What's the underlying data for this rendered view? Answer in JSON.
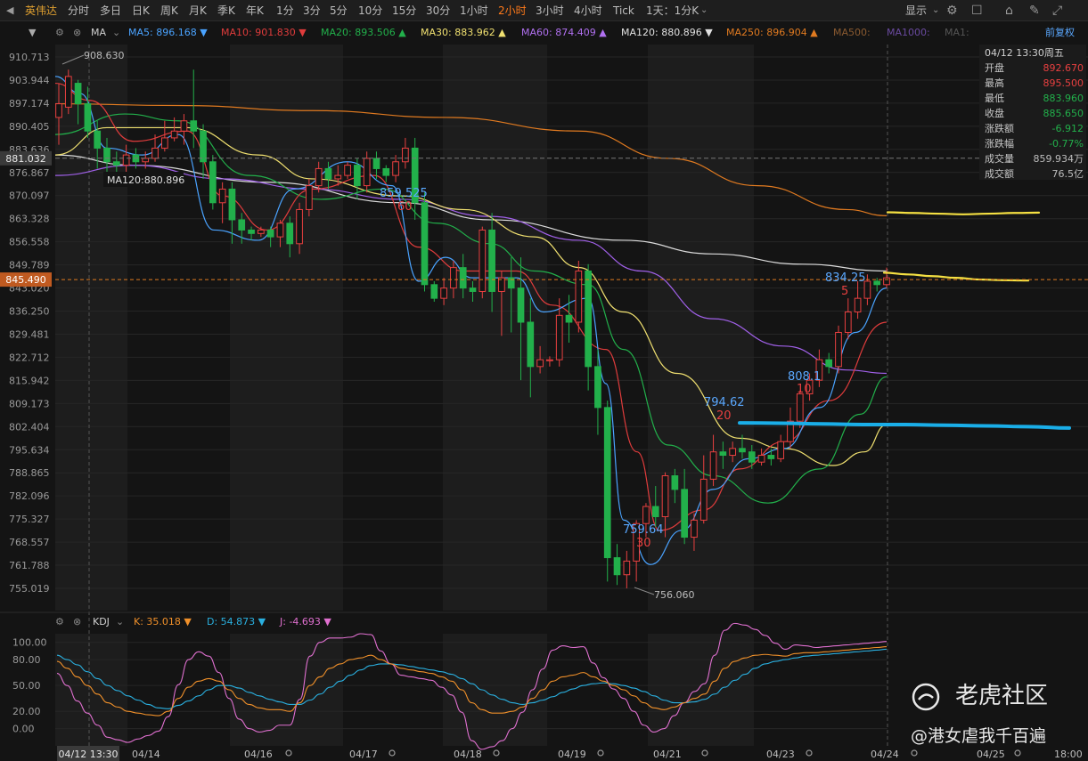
{
  "toolbar": {
    "symbol": "英伟达",
    "periods": [
      "分时",
      "多日",
      "日K",
      "周K",
      "月K",
      "季K",
      "年K",
      "1分",
      "3分",
      "5分",
      "10分",
      "15分",
      "30分",
      "1小时",
      "2小时",
      "3小时",
      "4小时",
      "Tick"
    ],
    "active_period": "2小时",
    "range": "1天：1分K",
    "display": "显示"
  },
  "indicators": {
    "ma_label": "MA",
    "ma": [
      {
        "name": "MA5",
        "value": "896.168",
        "color": "#4aa3ff",
        "dir": "▼"
      },
      {
        "name": "MA10",
        "value": "901.830",
        "color": "#e03c3c",
        "dir": "▼"
      },
      {
        "name": "MA20",
        "value": "893.506",
        "color": "#22b04b",
        "dir": "▲"
      },
      {
        "name": "MA30",
        "value": "883.962",
        "color": "#f0e070",
        "dir": "▲"
      },
      {
        "name": "MA60",
        "value": "874.409",
        "color": "#b070f0",
        "dir": "▲"
      },
      {
        "name": "MA120",
        "value": "880.896",
        "color": "#e0e0e0",
        "dir": "▼"
      },
      {
        "name": "MA250",
        "value": "896.904",
        "color": "#e07a20",
        "dir": "▲"
      },
      {
        "name": "MA500",
        "value": "",
        "color": "#8a5a30",
        "dir": ""
      },
      {
        "name": "MA1000",
        "value": "",
        "color": "#6a4aa0",
        "dir": ""
      },
      {
        "name": "MA1",
        "value": "",
        "color": "#555555",
        "dir": ""
      }
    ],
    "restore": "前复权",
    "kdj_label": "KDJ",
    "kdj": [
      {
        "name": "K",
        "value": "35.018",
        "color": "#f0902a",
        "dir": "▼"
      },
      {
        "name": "D",
        "value": "54.873",
        "color": "#2ab0e0",
        "dir": "▼"
      },
      {
        "name": "J",
        "value": "-4.693",
        "color": "#e070d0",
        "dir": "▼"
      }
    ]
  },
  "info_panel": {
    "datetime": "04/12 13:30周五",
    "rows": [
      {
        "label": "开盘",
        "value": "892.670",
        "color": "#e84040"
      },
      {
        "label": "最高",
        "value": "895.500",
        "color": "#e84040"
      },
      {
        "label": "最低",
        "value": "883.960",
        "color": "#22b04b"
      },
      {
        "label": "收盘",
        "value": "885.650",
        "color": "#22b04b"
      },
      {
        "label": "涨跌额",
        "value": "-6.912",
        "color": "#22b04b"
      },
      {
        "label": "涨跌幅",
        "value": "-0.77%",
        "color": "#22b04b"
      },
      {
        "label": "成交量",
        "value": "859.934万",
        "color": "#bdbdbd"
      },
      {
        "label": "成交额",
        "value": "76.5亿",
        "color": "#bdbdbd"
      }
    ]
  },
  "watermark": {
    "brand": "老虎社区",
    "handle": "@港女虐我千百遍"
  },
  "chart_data": {
    "type": "candlestick",
    "y_ticks": [
      "910.713",
      "903.944",
      "897.174",
      "890.405",
      "883.636",
      "876.867",
      "870.097",
      "863.328",
      "856.558",
      "849.789",
      "843.020",
      "836.250",
      "829.481",
      "822.712",
      "815.942",
      "809.173",
      "802.404",
      "795.634",
      "788.865",
      "782.096",
      "775.327",
      "768.557",
      "761.788",
      "755.019"
    ],
    "y_range": [
      755.019,
      910.713
    ],
    "cursor_price": "881.032",
    "last_price": "845.490",
    "crosshair_label": "MA120:880.896",
    "x_labels": [
      "04/12 13:30",
      "04/14",
      "04/16",
      "04/17",
      "04/18",
      "04/19",
      "04/21",
      "04/23",
      "04/24",
      "04/25",
      "18:00"
    ],
    "candles": [
      [
        893,
        897,
        885,
        903
      ],
      [
        896,
        905,
        894,
        907
      ],
      [
        903,
        897,
        891,
        904
      ],
      [
        897,
        889,
        887,
        902
      ],
      [
        889,
        884,
        878,
        892
      ],
      [
        884,
        880,
        877,
        887
      ],
      [
        880,
        879,
        875,
        883
      ],
      [
        879,
        882,
        876,
        885
      ],
      [
        882,
        880,
        878,
        884
      ],
      [
        880,
        881,
        878,
        883
      ],
      [
        881,
        884,
        880,
        888
      ],
      [
        884,
        887,
        883,
        892
      ],
      [
        887,
        889,
        886,
        893
      ],
      [
        889,
        892,
        885,
        894
      ],
      [
        892,
        889,
        884,
        907
      ],
      [
        889,
        880,
        875,
        891
      ],
      [
        880,
        868,
        866,
        882
      ],
      [
        868,
        872,
        862,
        874
      ],
      [
        872,
        863,
        856,
        874
      ],
      [
        863,
        860,
        856,
        865
      ],
      [
        860,
        859,
        857,
        861
      ],
      [
        859,
        860,
        858,
        861
      ],
      [
        860,
        858,
        855,
        861
      ],
      [
        858,
        862,
        855,
        863
      ],
      [
        862,
        856,
        852,
        864
      ],
      [
        856,
        866,
        853,
        868
      ],
      [
        866,
        873,
        864,
        875
      ],
      [
        873,
        878,
        871,
        880
      ],
      [
        878,
        875,
        872,
        880
      ],
      [
        875,
        876,
        873,
        879
      ],
      [
        876,
        879,
        875,
        880
      ],
      [
        879,
        873,
        869,
        881
      ],
      [
        873,
        881,
        871,
        883
      ],
      [
        881,
        878,
        875,
        883
      ],
      [
        878,
        876,
        874,
        879
      ],
      [
        876,
        880,
        874,
        882
      ],
      [
        880,
        884,
        878,
        887
      ],
      [
        884,
        868,
        863,
        887
      ],
      [
        868,
        844,
        842,
        871
      ],
      [
        844,
        840,
        839,
        845
      ],
      [
        840,
        843,
        838,
        846
      ],
      [
        843,
        849,
        840,
        851
      ],
      [
        849,
        843,
        840,
        853
      ],
      [
        843,
        842,
        839,
        845
      ],
      [
        842,
        860,
        840,
        861
      ],
      [
        860,
        842,
        836,
        865
      ],
      [
        842,
        846,
        829,
        848
      ],
      [
        846,
        843,
        830,
        852
      ],
      [
        843,
        833,
        816,
        852
      ],
      [
        833,
        820,
        811,
        840
      ],
      [
        820,
        822,
        818,
        826
      ],
      [
        822,
        822,
        820,
        823
      ],
      [
        822,
        835,
        820,
        840
      ],
      [
        835,
        833,
        827,
        841
      ],
      [
        833,
        848,
        830,
        851
      ],
      [
        848,
        820,
        813,
        850
      ],
      [
        820,
        808,
        800,
        825
      ],
      [
        808,
        764,
        757,
        810
      ],
      [
        764,
        759,
        756,
        768
      ],
      [
        759,
        763,
        755,
        766
      ],
      [
        763,
        774,
        757,
        775
      ],
      [
        774,
        779,
        770,
        780
      ],
      [
        779,
        776,
        773,
        785
      ],
      [
        776,
        788,
        770,
        789
      ],
      [
        788,
        784,
        780,
        790
      ],
      [
        784,
        770,
        768,
        790
      ],
      [
        770,
        775,
        766,
        777
      ],
      [
        775,
        787,
        774,
        794
      ],
      [
        787,
        795,
        785,
        800
      ],
      [
        795,
        794,
        790,
        798
      ],
      [
        794,
        796,
        792,
        798
      ],
      [
        796,
        795,
        793,
        800
      ],
      [
        795,
        792,
        790,
        797
      ],
      [
        792,
        794,
        791,
        796
      ],
      [
        794,
        793,
        791,
        796
      ],
      [
        793,
        798,
        792,
        800
      ],
      [
        798,
        804,
        796,
        808
      ],
      [
        804,
        812,
        802,
        813
      ],
      [
        812,
        816,
        810,
        818
      ],
      [
        816,
        822,
        814,
        825
      ],
      [
        822,
        820,
        818,
        824
      ],
      [
        820,
        830,
        818,
        832
      ],
      [
        830,
        836,
        828,
        840
      ],
      [
        836,
        840,
        834,
        845
      ],
      [
        840,
        845,
        838,
        847
      ],
      [
        845,
        844,
        842,
        846
      ],
      [
        844,
        846,
        843,
        849
      ]
    ],
    "annotations": [
      {
        "text": "908.630",
        "kind": "high"
      },
      {
        "text": "756.060",
        "kind": "low"
      },
      {
        "text": "859.525",
        "kind": "pivot",
        "color": "#5aa8ff"
      },
      {
        "text": "60",
        "kind": "pivot",
        "color": "#e84040"
      },
      {
        "text": "759.64",
        "kind": "pivot",
        "color": "#5aa8ff"
      },
      {
        "text": "30",
        "kind": "pivot",
        "color": "#e84040"
      },
      {
        "text": "794.62",
        "kind": "pivot",
        "color": "#5aa8ff"
      },
      {
        "text": "20",
        "kind": "pivot",
        "color": "#e84040"
      },
      {
        "text": "808.1",
        "kind": "pivot",
        "color": "#5aa8ff"
      },
      {
        "text": "10",
        "kind": "pivot",
        "color": "#e84040"
      },
      {
        "text": "834.25",
        "kind": "pivot",
        "color": "#5aa8ff"
      },
      {
        "text": "5",
        "kind": "pivot",
        "color": "#e84040"
      }
    ],
    "kdj_ticks": [
      "100.00",
      "80.00",
      "50.00",
      "20.00",
      "0.00"
    ],
    "kdj_range": [
      -20,
      110
    ],
    "kdj_series": {
      "K": [
        78,
        70,
        60,
        50,
        40,
        30,
        25,
        20,
        18,
        16,
        15,
        20,
        35,
        48,
        55,
        58,
        55,
        45,
        35,
        28,
        24,
        22,
        22,
        20,
        30,
        50,
        60,
        70,
        75,
        80,
        82,
        85,
        80,
        75,
        70,
        68,
        66,
        64,
        60,
        55,
        45,
        30,
        22,
        18,
        18,
        20,
        25,
        35,
        45,
        55,
        60,
        62,
        65,
        60,
        55,
        50,
        45,
        38,
        30,
        24,
        22,
        25,
        30,
        35,
        40,
        55,
        70,
        78,
        82,
        85,
        86,
        85,
        84,
        87,
        88,
        88,
        89,
        90,
        91,
        92,
        93,
        94,
        95
      ],
      "D": [
        85,
        80,
        74,
        66,
        58,
        50,
        44,
        38,
        33,
        28,
        24,
        23,
        27,
        32,
        38,
        45,
        50,
        50,
        47,
        42,
        38,
        34,
        31,
        28,
        28,
        33,
        40,
        48,
        55,
        62,
        68,
        73,
        75,
        75,
        74,
        72,
        70,
        68,
        66,
        63,
        58,
        52,
        45,
        39,
        34,
        30,
        28,
        30,
        33,
        37,
        42,
        46,
        50,
        52,
        53,
        52,
        50,
        47,
        43,
        38,
        33,
        30,
        30,
        31,
        34,
        40,
        48,
        56,
        63,
        70,
        75,
        78,
        80,
        82,
        84,
        85,
        86,
        87,
        88,
        89,
        90,
        91,
        92
      ],
      "J": [
        64,
        50,
        32,
        18,
        4,
        -10,
        -13,
        -16,
        -12,
        -8,
        -3,
        14,
        51,
        80,
        89,
        84,
        65,
        35,
        11,
        0,
        -4,
        -2,
        4,
        4,
        34,
        84,
        100,
        105,
        105,
        106,
        110,
        109,
        90,
        75,
        62,
        60,
        58,
        56,
        48,
        39,
        19,
        -14,
        -24,
        -21,
        -14,
        0,
        19,
        45,
        69,
        91,
        96,
        94,
        95,
        76,
        59,
        46,
        35,
        20,
        4,
        -4,
        0,
        15,
        30,
        43,
        52,
        85,
        114,
        122,
        120,
        115,
        108,
        99,
        92,
        97,
        96,
        94,
        95,
        96,
        97,
        98,
        99,
        100,
        101
      ]
    },
    "projections": [
      {
        "name": "upper-yellow",
        "color": "#f5e042",
        "values": [
          865.2,
          865.0,
          864.8,
          864.6,
          864.8,
          865.0,
          865.1
        ]
      },
      {
        "name": "mid-yellow",
        "color": "#f5e042",
        "values": [
          847.5,
          847.0,
          846.5,
          846.0,
          845.5,
          845.3,
          845.2
        ]
      },
      {
        "name": "cyan-level",
        "color": "#1aaee8",
        "values": [
          803.5,
          803.4,
          803.2,
          803.0,
          803.0,
          802.8,
          802.6,
          802.4,
          802.0
        ]
      }
    ]
  }
}
